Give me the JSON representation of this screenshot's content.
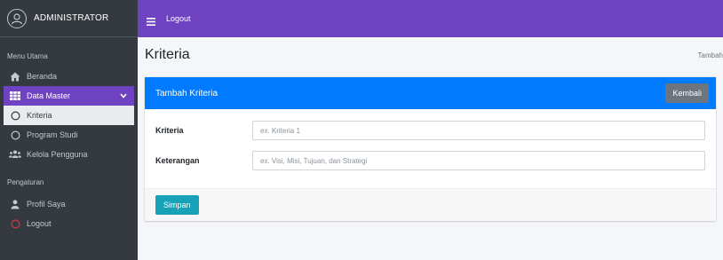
{
  "brand": {
    "name": "ADMINISTRATOR"
  },
  "sidebar": {
    "header_main": "Menu Utama",
    "items": [
      {
        "label": "Beranda",
        "icon": "home-icon"
      },
      {
        "label": "Data Master",
        "icon": "grid-icon"
      },
      {
        "label": "Kriteria",
        "icon": "circle-icon"
      },
      {
        "label": "Program Studi",
        "icon": "circle-icon"
      },
      {
        "label": "Kelola Pengguna",
        "icon": "users-icon"
      }
    ],
    "header_settings": "Pengaturan",
    "settings_items": [
      {
        "label": "Profil Saya",
        "icon": "user-icon"
      },
      {
        "label": "Logout",
        "icon": "circle-icon"
      }
    ]
  },
  "topbar": {
    "logout": "Logout"
  },
  "page": {
    "title": "Kriteria",
    "breadcrumb": "Tambah"
  },
  "card": {
    "title": "Tambah Kriteria",
    "back_label": "Kembali",
    "fields": [
      {
        "label": "Kriteria",
        "placeholder": "ex. Kriteria 1"
      },
      {
        "label": "Keterangan",
        "placeholder": "ex. Visi, Misi, Tujuan, dan Strategi"
      }
    ],
    "save_label": "Simpan"
  },
  "colors": {
    "sidebar_bg": "#343a40",
    "accent_purple": "#6f42c1",
    "card_header_blue": "#007bff",
    "save_button": "#17a2b8",
    "back_button": "#6c757d",
    "logout_icon": "#dc3545"
  }
}
